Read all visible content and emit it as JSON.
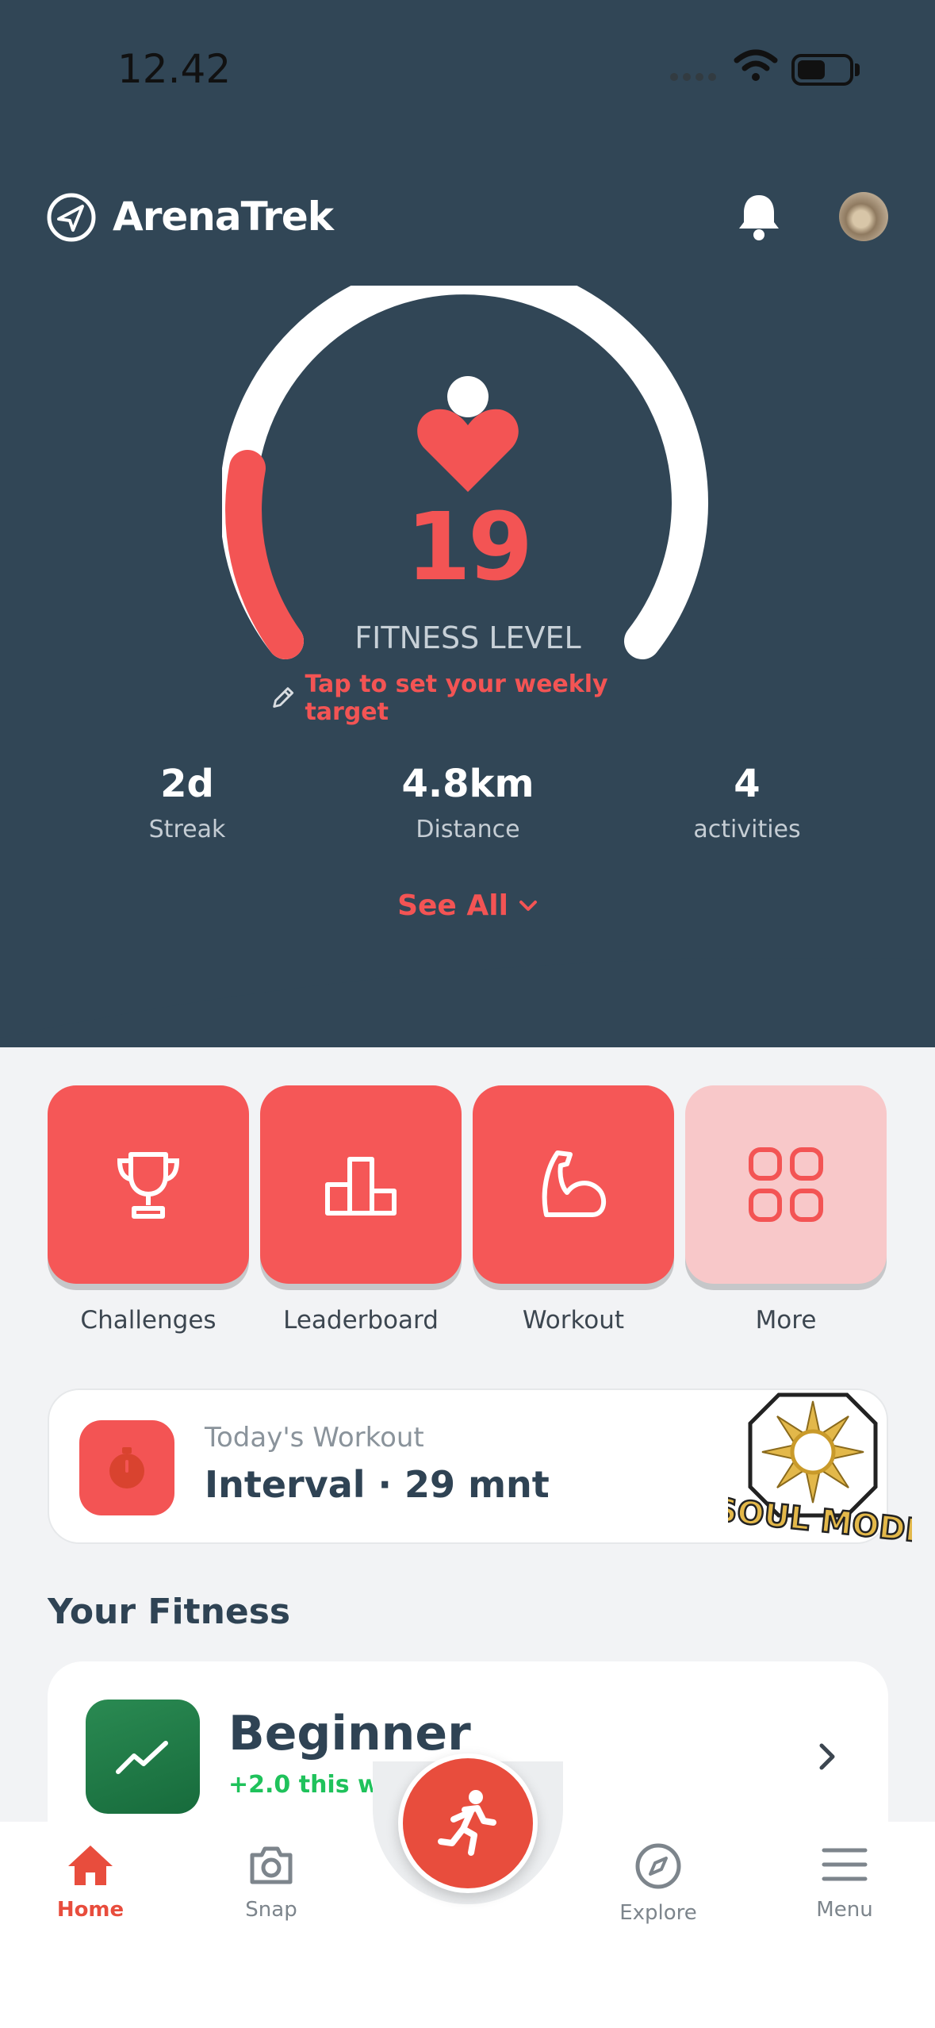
{
  "status_bar": {
    "time": "12.42"
  },
  "header": {
    "app_name": "ArenaTrek"
  },
  "fitness_gauge": {
    "value": "19",
    "label": "FITNESS LEVEL",
    "target_link": "Tap to set your weekly target",
    "progress_fraction": 0.17
  },
  "stats": [
    {
      "value": "2d",
      "label": "Streak"
    },
    {
      "value": "4.8km",
      "label": "Distance"
    },
    {
      "value": "4",
      "label": "activities"
    }
  ],
  "see_all": "See All",
  "quick_actions": [
    {
      "label": "Challenges",
      "icon": "trophy-icon"
    },
    {
      "label": "Leaderboard",
      "icon": "bar-chart-icon"
    },
    {
      "label": "Workout",
      "icon": "flexed-arm-icon"
    },
    {
      "label": "More",
      "icon": "grid-icon"
    }
  ],
  "todays_workout": {
    "subtitle": "Today's Workout",
    "title": "Interval · 29 mnt",
    "icon": "stopwatch-icon"
  },
  "badge": {
    "text": "SOUL MODE"
  },
  "section_title": "Your Fitness",
  "fitness_card": {
    "level": "Beginner",
    "delta": "+2.0 this week",
    "icon": "trend-up-icon"
  },
  "bottom_nav": [
    {
      "label": "Home",
      "icon": "home-icon",
      "active": true
    },
    {
      "label": "Snap",
      "icon": "camera-icon"
    },
    {
      "label": "Explore",
      "icon": "compass-icon"
    },
    {
      "label": "Menu",
      "icon": "hamburger-menu-icon"
    }
  ],
  "fab_icon": "running-person-icon",
  "colors": {
    "hero_bg": "#314656",
    "accent": "#f35454",
    "tile_more": "#f8c8c9",
    "positive": "#1fc25b"
  }
}
